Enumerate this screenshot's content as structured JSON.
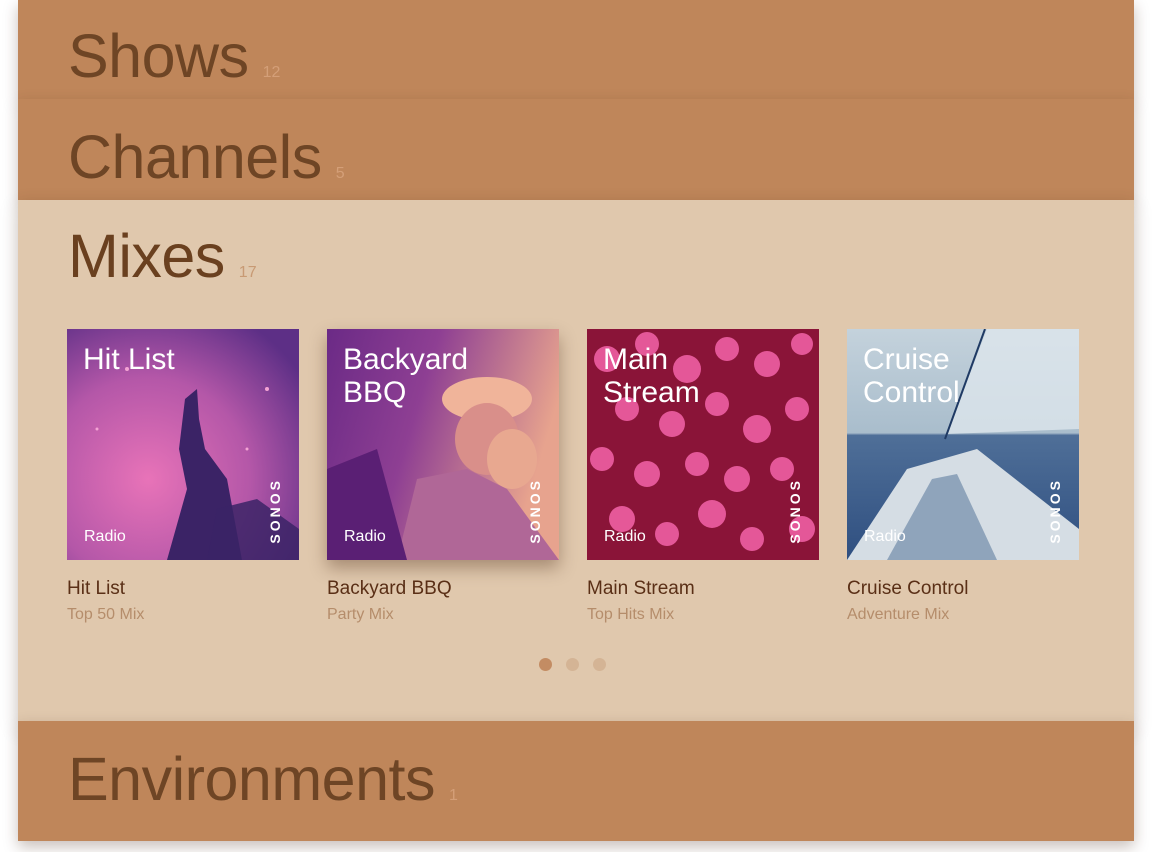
{
  "panels": {
    "shows": {
      "title": "Shows",
      "count": "12"
    },
    "channels": {
      "title": "Channels",
      "count": "5"
    },
    "mixes": {
      "title": "Mixes",
      "count": "17"
    },
    "environments": {
      "title": "Environments",
      "count": "1"
    }
  },
  "mixes": {
    "cards": [
      {
        "art_title": "Hit List",
        "tag": "Radio",
        "brand": "SONOS",
        "title": "Hit List",
        "subtitle": "Top 50 Mix"
      },
      {
        "art_title": "Backyard\nBBQ",
        "tag": "Radio",
        "brand": "SONOS",
        "title": "Backyard BBQ",
        "subtitle": "Party Mix"
      },
      {
        "art_title": "Main\nStream",
        "tag": "Radio",
        "brand": "SONOS",
        "title": "Main Stream",
        "subtitle": "Top Hits Mix"
      },
      {
        "art_title": "Cruise\nControl",
        "tag": "Radio",
        "brand": "SONOS",
        "title": "Cruise Control",
        "subtitle": "Adventure Mix"
      }
    ],
    "page_indicator": {
      "pages": 3,
      "current": 1
    }
  },
  "colors": {
    "panel_collapsed": "#bf865a",
    "panel_expanded": "#e0c8ad",
    "title_text": "#6e4525"
  }
}
